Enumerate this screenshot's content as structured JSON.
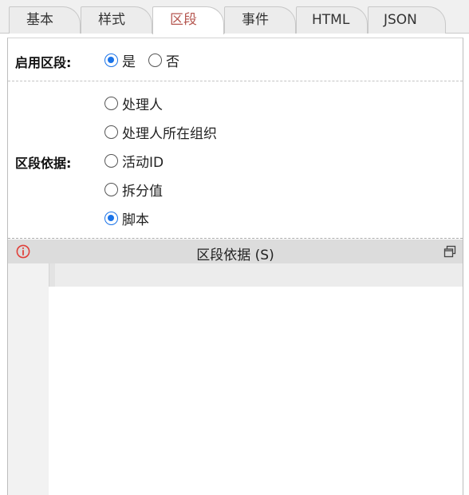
{
  "tabs": [
    {
      "label": "基本",
      "active": false
    },
    {
      "label": "样式",
      "active": false
    },
    {
      "label": "区段",
      "active": true
    },
    {
      "label": "事件",
      "active": false
    },
    {
      "label": "HTML",
      "active": false
    },
    {
      "label": "JSON",
      "active": false
    }
  ],
  "enable_section": {
    "label": "启用区段:",
    "options": [
      {
        "label": "是",
        "checked": true
      },
      {
        "label": "否",
        "checked": false
      }
    ]
  },
  "section_basis": {
    "label": "区段依据:",
    "options": [
      {
        "label": "处理人",
        "checked": false
      },
      {
        "label": "处理人所在组织",
        "checked": false
      },
      {
        "label": "活动ID",
        "checked": false
      },
      {
        "label": "拆分值",
        "checked": false
      },
      {
        "label": "脚本",
        "checked": true
      }
    ]
  },
  "editor": {
    "title": "区段依据 (S)",
    "info_icon": "info-icon",
    "restore_icon": "window-restore-icon",
    "code": ""
  },
  "colors": {
    "active_tab_text": "#b5564f",
    "radio_checked": "#1a73e8",
    "info_icon": "#e0403a"
  }
}
